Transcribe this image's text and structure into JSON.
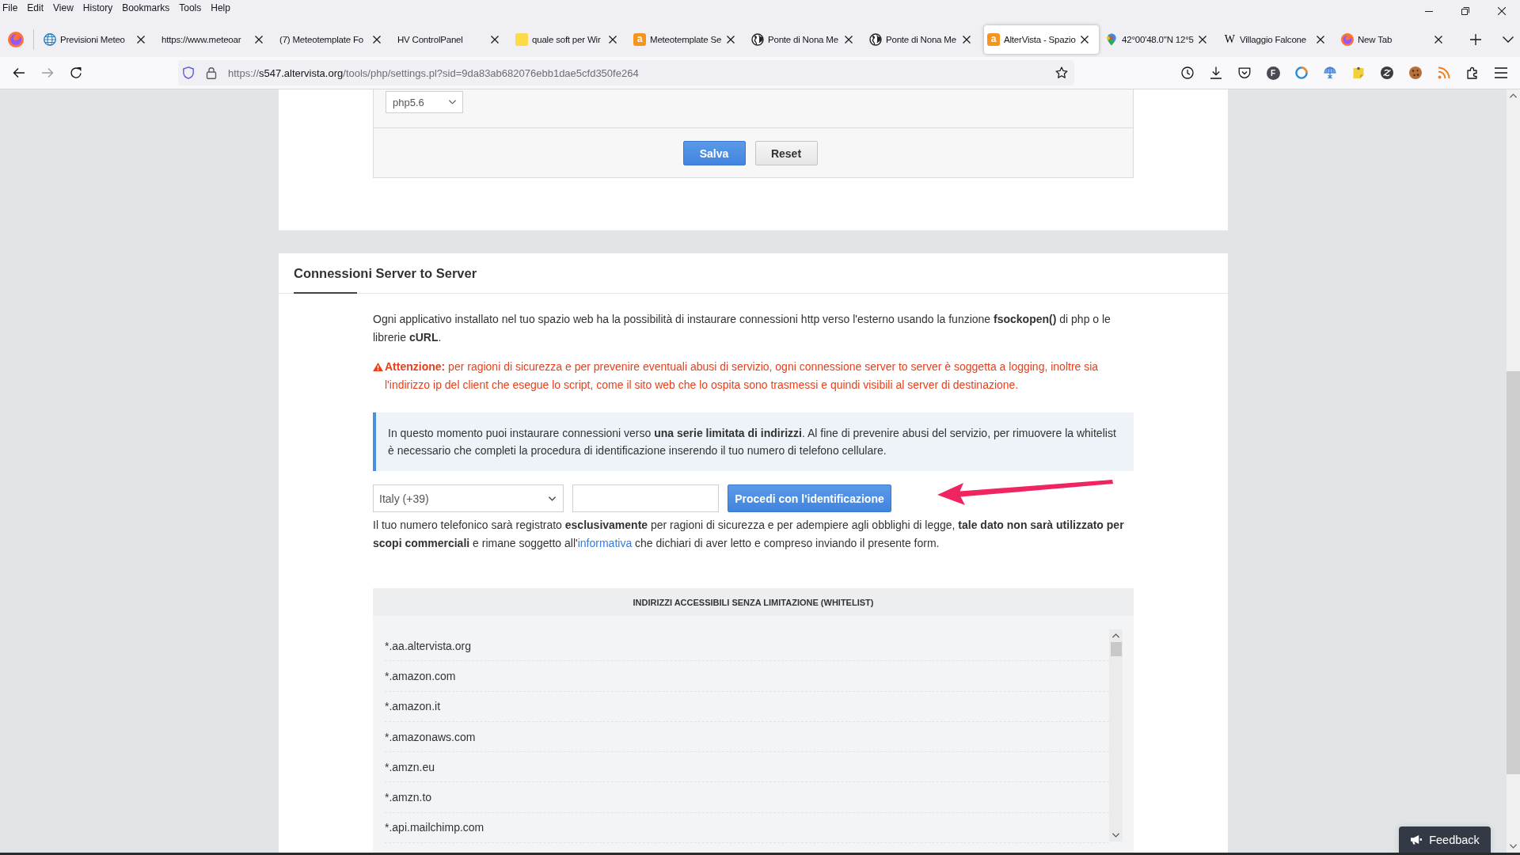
{
  "menu_bar": [
    "File",
    "Edit",
    "View",
    "History",
    "Bookmarks",
    "Tools",
    "Help"
  ],
  "tabs": [
    {
      "title": "Previsioni Meteo",
      "kind": "globe",
      "selected": false
    },
    {
      "title": "https://www.meteoar",
      "kind": "blank",
      "selected": false
    },
    {
      "title": "(7) Meteotemplate Fo",
      "kind": "blank",
      "selected": false
    },
    {
      "title": "HV ControlPanel",
      "kind": "blank",
      "selected": false
    },
    {
      "title": "quale soft per Wir",
      "kind": "note",
      "selected": false
    },
    {
      "title": "Meteotemplate Se",
      "kind": "badge",
      "favicon_text": "a",
      "selected": false
    },
    {
      "title": "Ponte di Nona Me",
      "kind": "earth",
      "selected": false
    },
    {
      "title": "Ponte di Nona Me",
      "kind": "earth",
      "selected": false
    },
    {
      "title": "AlterVista - Spazio",
      "kind": "badge",
      "favicon_text": "a",
      "selected": true
    },
    {
      "title": "42°00'48.0\"N 12°5",
      "kind": "pin",
      "selected": false
    },
    {
      "title": "Villaggio Falcone",
      "kind": "letter",
      "favicon_text": "W",
      "selected": false
    },
    {
      "title": "New Tab",
      "kind": "firefox",
      "selected": false
    }
  ],
  "nav_buttons": [
    {
      "kind": "back",
      "disabled": false
    },
    {
      "kind": "forward",
      "disabled": true
    },
    {
      "kind": "reload",
      "disabled": false
    }
  ],
  "address_bar": {
    "prefix": "https://",
    "host": "s547.altervista.org",
    "path": "/tools/php/settings.pl?sid=9da83ab682076ebb1dae5cfd350fe264"
  },
  "toolbar": [
    {
      "kind": "history"
    },
    {
      "kind": "downloads"
    },
    {
      "kind": "pocket"
    },
    {
      "kind": "letter",
      "text": "F"
    },
    {
      "kind": "ring"
    },
    {
      "kind": "globe"
    },
    {
      "kind": "note"
    },
    {
      "kind": "swirl"
    },
    {
      "kind": "cookie"
    },
    {
      "kind": "feed"
    },
    {
      "kind": "extensions"
    },
    {
      "kind": "menu"
    }
  ],
  "php_panel": {
    "version": "php5.6",
    "buttons": [
      {
        "label": "Salva",
        "kind": "primary"
      },
      {
        "label": "Reset",
        "kind": "secondary"
      }
    ]
  },
  "server_connections": {
    "title": "Connessioni Server to Server",
    "intro": "Ogni applicativo installato nel tuo spazio web ha la possibilità di instaurare connessioni http verso l'esterno usando la funzione **fsockopen()** di php o le librerie **cURL**.",
    "warning": "**Attenzione:** per ragioni di sicurezza e per prevenire eventuali abusi di servizio, ogni connessione server to server è soggetta a logging, inoltre sia l'indirizzo ip del client che esegue lo script, come il sito web che lo ospita sono trasmessi e quindi visibili al server di destinazione.",
    "info": "In questo momento puoi instaurare connessioni verso **una serie limitata di indirizzi**. Al fine di prevenire abusi del servizio, per rimuovere la whitelist è necessario che completi la procedura di identificazione inserendo il tuo numero di telefono cellulare.",
    "country_select": "Italy (+39)",
    "identify_button": "Procedi con l'identificazione",
    "note": {
      "before": "Il tuo numero telefonico sarà registrato **esclusivamente** per ragioni di sicurezza e per adempiere agli obblighi di legge, **tale dato non sarà utilizzato per scopi commerciali** e rimane soggetto all'",
      "link": "informativa",
      "after": " che dichiari di aver letto e compreso inviando il presente form."
    },
    "whitelist": {
      "title": "INDIRIZZI ACCESSIBILI SENZA LIMITAZIONE (WHITELIST)",
      "items": [
        "*.aa.altervista.org",
        "*.amazon.com",
        "*.amazon.it",
        "*.amazonaws.com",
        "*.amzn.eu",
        "*.amzn.to",
        "*.api.mailchimp.com"
      ]
    }
  },
  "feedback": {
    "label": "Feedback"
  }
}
